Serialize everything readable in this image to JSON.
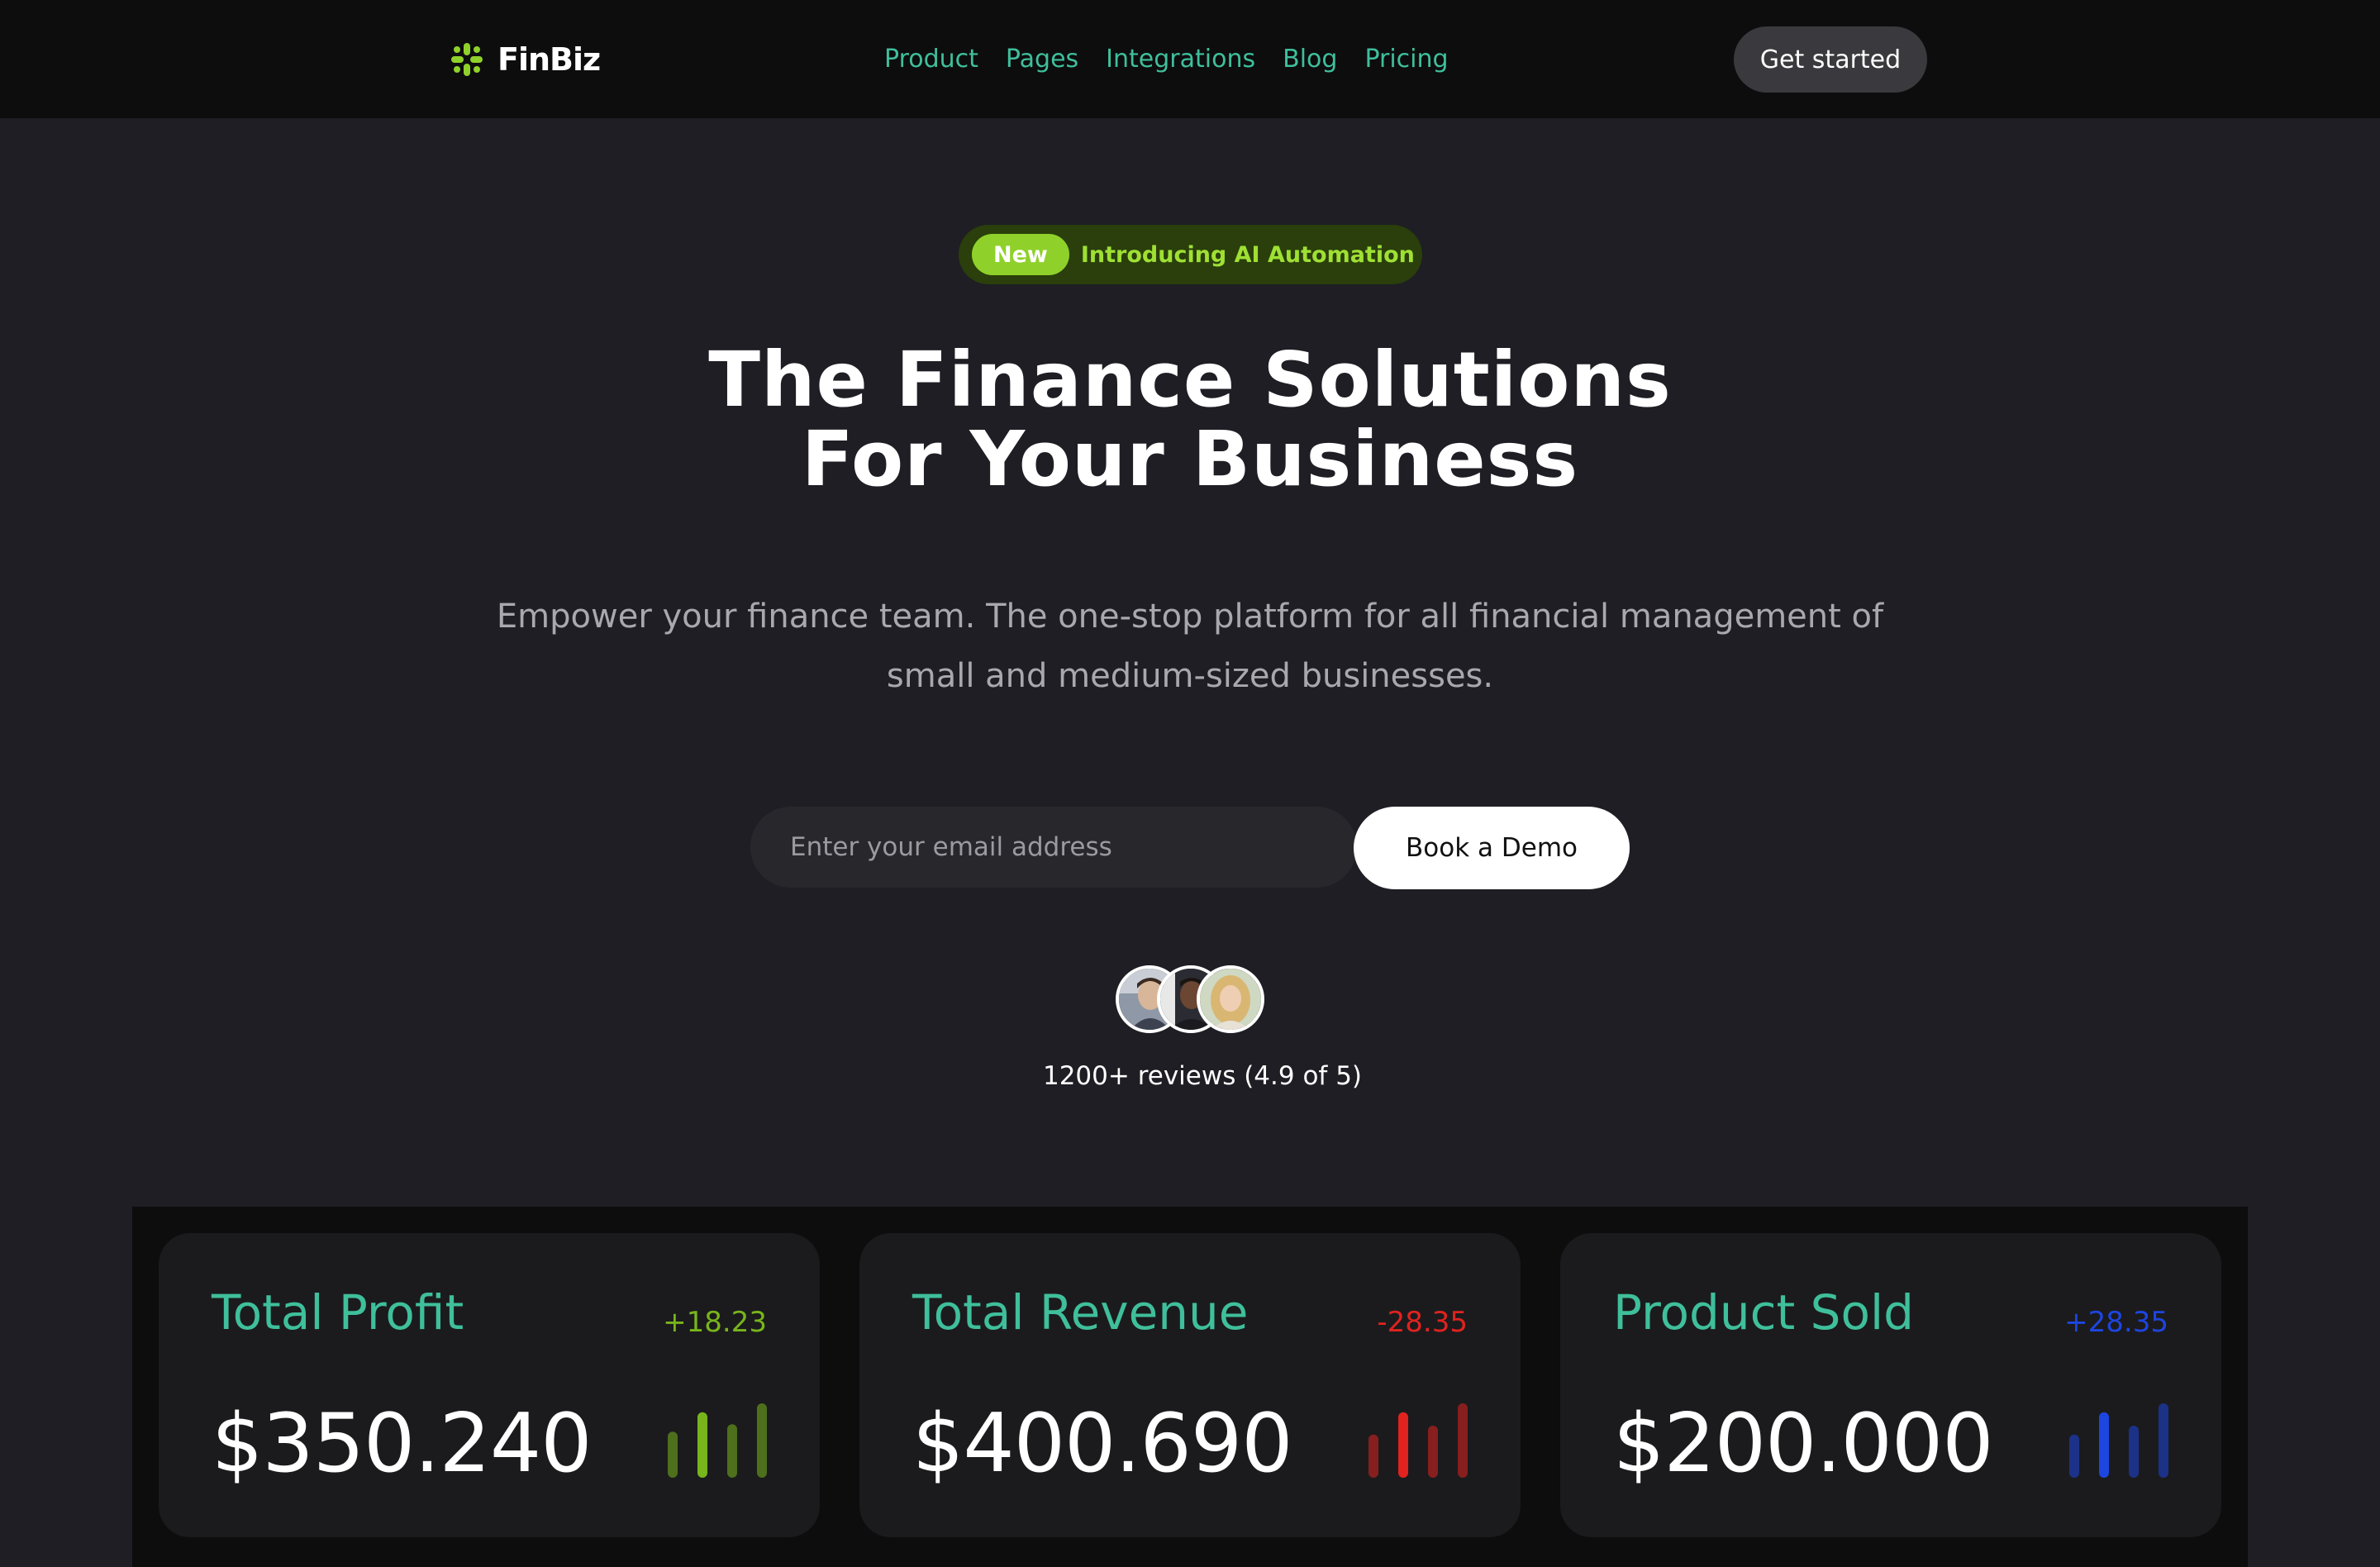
{
  "brand": {
    "name": "FinBiz",
    "accent": "#8fd12a"
  },
  "nav": {
    "items": [
      {
        "label": "Product"
      },
      {
        "label": "Pages"
      },
      {
        "label": "Integrations"
      },
      {
        "label": "Blog"
      },
      {
        "label": "Pricing"
      }
    ],
    "cta_label": "Get started",
    "link_color": "#3fbf9b"
  },
  "hero": {
    "badge": {
      "pill": "New",
      "text": "Introducing AI Automation",
      "icon": "arrow-right-icon"
    },
    "title_line1": "The Finance Solutions",
    "title_line2": "For Your Business",
    "subtitle": "Empower your finance team. The one-stop platform for all financial management of small and medium-sized businesses.",
    "email_placeholder": "Enter your email address",
    "demo_label": "Book a Demo",
    "reviews": "1200+ reviews (4.9 of 5)"
  },
  "stats": [
    {
      "title": "Total Profit",
      "change": "+18.23",
      "value": "$350.240",
      "color": "#78b51c",
      "bar_levels": [
        0.62,
        0.88,
        0.72,
        1.0
      ]
    },
    {
      "title": "Total Revenue",
      "change": "-28.35",
      "value": "$400.690",
      "color": "#e0231f",
      "bar_levels": [
        0.58,
        0.88,
        0.7,
        1.0
      ]
    },
    {
      "title": "Product Sold",
      "change": "+28.35",
      "value": "$200.000",
      "color": "#1d45e0",
      "bar_levels": [
        0.58,
        0.88,
        0.7,
        1.0
      ]
    }
  ]
}
